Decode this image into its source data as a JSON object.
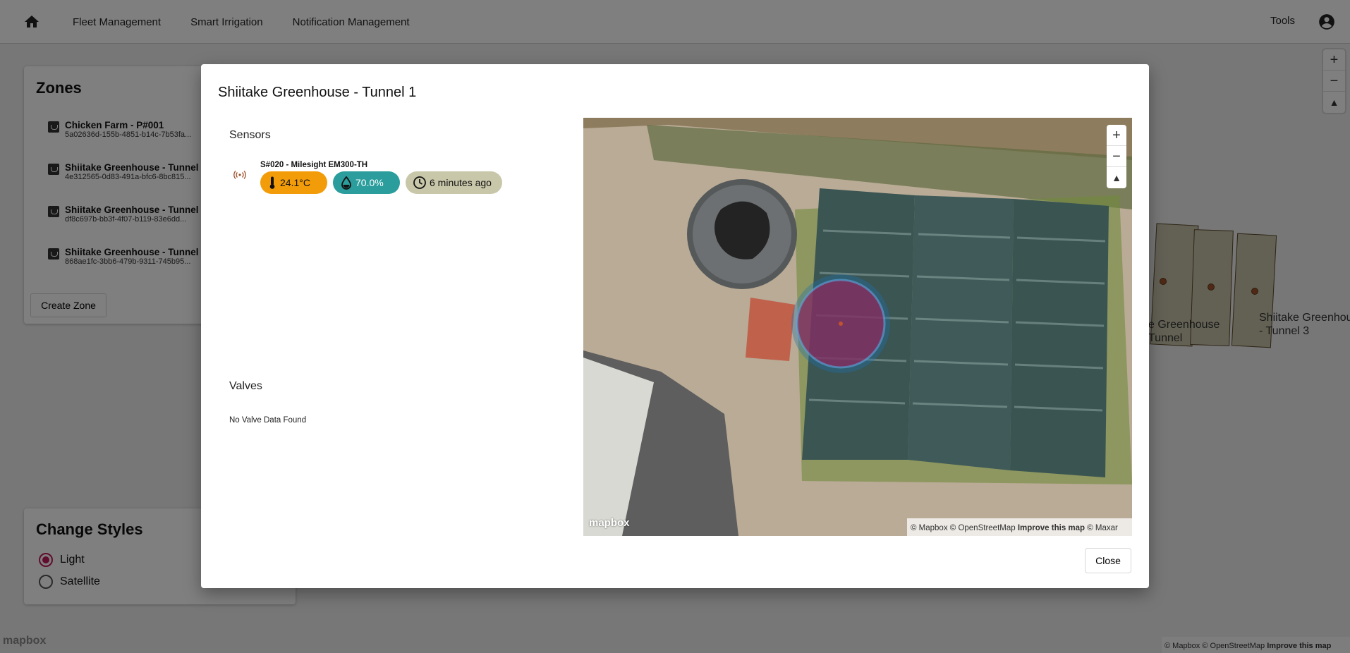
{
  "nav": {
    "home_icon": "home-icon",
    "links": [
      "Fleet Management",
      "Smart Irrigation",
      "Notification Management"
    ],
    "tools": "Tools",
    "account_icon": "account-circle-icon"
  },
  "zones": {
    "title": "Zones",
    "items": [
      {
        "name": "Chicken Farm - P#001",
        "id": "5a02636d-155b-4851-b14c-7b53fa..."
      },
      {
        "name": "Shiitake Greenhouse - Tunnel",
        "id": "4e312565-0d83-491a-bfc6-8bc815..."
      },
      {
        "name": "Shiitake Greenhouse - Tunnel",
        "id": "df8c697b-bb3f-4f07-b119-83e6dd..."
      },
      {
        "name": "Shiitake Greenhouse - Tunnel",
        "id": "868ae1fc-3bb6-479b-9311-745b95..."
      }
    ],
    "create_button": "Create Zone"
  },
  "styles": {
    "title": "Change Styles",
    "options": [
      {
        "label": "Light",
        "selected": true
      },
      {
        "label": "Satellite",
        "selected": false
      }
    ]
  },
  "background_map": {
    "labels": [
      "e Greenhouse",
      "Tunnel",
      "Shiitake Greenhous",
      "- Tunnel 3"
    ],
    "logo": "mapbox",
    "attribution": {
      "copy": "© Mapbox © OpenStreetMap",
      "improve": "Improve this map"
    }
  },
  "dialog": {
    "title": "Shiitake Greenhouse - Tunnel 1",
    "sensors_title": "Sensors",
    "sensor": {
      "name": "S#020 - Milesight EM300-TH",
      "temperature": "24.1°C",
      "humidity": "70.0%",
      "last_seen": "6 minutes ago"
    },
    "valves_title": "Valves",
    "valves_empty": "No Valve Data Found",
    "map": {
      "logo": "mapbox",
      "attribution": {
        "copy": "© Mapbox © OpenStreetMap",
        "improve": "Improve this map",
        "maxar": "© Maxar"
      }
    },
    "close": "Close"
  },
  "colors": {
    "accent": "#c2185b",
    "temperature_chip": "#f39c0a",
    "humidity_chip": "#2a9d9c",
    "time_chip": "#c9c7a9"
  }
}
